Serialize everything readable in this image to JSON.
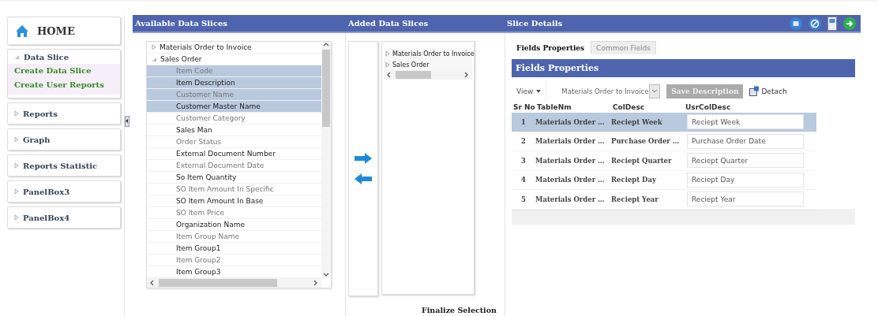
{
  "sidebar": {
    "home": "HOME",
    "groups": [
      {
        "label": "Data Slice",
        "expanded": true,
        "items": [
          "Create Data Slice",
          "Create User Reports"
        ]
      },
      {
        "label": "Reports",
        "expanded": false
      },
      {
        "label": "Graph",
        "expanded": false
      },
      {
        "label": "Reports Statistic",
        "expanded": false
      },
      {
        "label": "PanelBox3",
        "expanded": false
      },
      {
        "label": "PanelBox4",
        "expanded": false
      }
    ]
  },
  "available": {
    "title": "Available Data Slices",
    "tree": [
      {
        "label": "Materials Order to Invoice",
        "expanded": false
      },
      {
        "label": "Sales Order",
        "expanded": true,
        "children": [
          {
            "label": "Item Code",
            "selected": true
          },
          {
            "label": "Item Description",
            "selected": true
          },
          {
            "label": "Customer Name",
            "selected": true
          },
          {
            "label": "Customer Master Name",
            "selected": true
          },
          {
            "label": "Customer Category",
            "selected": false
          },
          {
            "label": "Sales Man",
            "selected": false
          },
          {
            "label": "Order Status",
            "selected": false
          },
          {
            "label": "External Document Number",
            "selected": false
          },
          {
            "label": "External Document Date",
            "selected": false
          },
          {
            "label": "So Item Quantity",
            "selected": false
          },
          {
            "label": "SO Item Amount In Specific",
            "selected": false
          },
          {
            "label": "SO Item Amount In Base",
            "selected": false
          },
          {
            "label": "SO Item Price",
            "selected": false
          },
          {
            "label": "Organization Name",
            "selected": false
          },
          {
            "label": "Item Group Name",
            "selected": false
          },
          {
            "label": "Item Group1",
            "selected": false
          },
          {
            "label": "Item Group2",
            "selected": false
          },
          {
            "label": "Item Group3",
            "selected": false
          }
        ]
      }
    ]
  },
  "added": {
    "title": "Added Data Slices",
    "tree": [
      {
        "label": "Materials Order to Invoice",
        "expanded": false
      },
      {
        "label": "Sales Order",
        "expanded": false
      }
    ],
    "finalize": "Finalize Selection"
  },
  "details": {
    "title": "Slice Details",
    "tabs": [
      {
        "label": "Fields Properties",
        "selected": true
      },
      {
        "label": "Common Fields",
        "selected": false
      }
    ],
    "panel_title": "Fields Properties",
    "view": "View",
    "dropdown": "Materials Order to Invoice",
    "save": {
      "label": "Save Description",
      "disabled": true
    },
    "detach": "Detach",
    "columns": [
      "Sr No",
      "TableNm",
      "ColDesc",
      "UsrColDesc"
    ],
    "rows": [
      {
        "sr": "1",
        "table": "Materials Order …",
        "col": "Reciept Week",
        "usr": "Reciept Week",
        "selected": true
      },
      {
        "sr": "2",
        "table": "Materials Order …",
        "col": "Purchase Order …",
        "usr": "Purchase Order Date",
        "selected": false
      },
      {
        "sr": "3",
        "table": "Materials Order …",
        "col": "Reciept Quarter",
        "usr": "Reciept Quarter",
        "selected": false
      },
      {
        "sr": "4",
        "table": "Materials Order …",
        "col": "Reciept Day",
        "usr": "Reciept Day",
        "selected": false
      },
      {
        "sr": "5",
        "table": "Materials Order …",
        "col": "Reciept Year",
        "usr": "Reciept Year",
        "selected": false
      }
    ]
  }
}
